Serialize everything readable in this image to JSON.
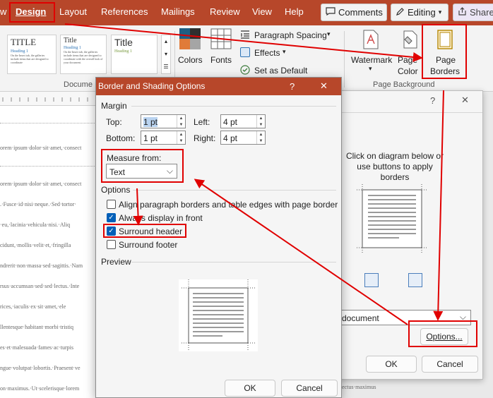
{
  "ribbon": {
    "tabs": [
      "w",
      "Design",
      "Layout",
      "References",
      "Mailings",
      "Review",
      "View",
      "Help"
    ],
    "comments_label": "Comments",
    "editing_label": "Editing",
    "share_label": "Share",
    "style_thumbs": [
      {
        "title": "TITLE",
        "heading": "Heading 1",
        "body": "On the Insert tab, the galleries include items that are designed to coordinate"
      },
      {
        "title": "Title",
        "heading": "Heading 1",
        "body": "On the Insert tab, the galleries include items that are designed to coordinate with the overall look of your document."
      },
      {
        "title": "Title",
        "heading": "Heading 1",
        "body": ""
      }
    ],
    "colors_label": "Colors",
    "fonts_label": "Fonts",
    "paragraph_spacing_label": "Paragraph Spacing",
    "effects_label": "Effects",
    "set_default_label": "Set as Default",
    "watermark_label": "Watermark",
    "page_color_label_1": "Page",
    "page_color_label_2": "Color",
    "page_borders_label_1": "Page",
    "page_borders_label_2": "Borders",
    "group_document_formatting": "Docume",
    "group_page_background": "Page Background"
  },
  "document": {
    "lines": [
      "orem·ipsum·dolor·sit·amet,·consect",
      "orem·ipsum·dolor·sit·amet,·consect",
      ".·Fusce·id·nisi·neque.·Sed·tortor·",
      "·eu,·lacinia·vehicula·nisi.·Aliq",
      "cidunt,·mollis·velit·et,·fringilla",
      "ndrerit·non·massa·sed·sagittis.·Nam",
      "rsus·accumsan·sed·sed·lectus.·Inte",
      "rices,·iaculis·ex·sit·amet,·ele",
      "llentesque·habitant·morbi·tristiq",
      "es·et·malesuada·fames·ac·turpis",
      "ngue·volutpat·lobortis.·Praesent·ve",
      "on·maximus.·Ut·scelerisque·lorem"
    ],
    "fragment_right": "ectus·maximus"
  },
  "bg_dialog": {
    "help_glyph": "?",
    "close_glyph": "✕",
    "instructions": "Click on diagram below or use buttons to apply borders",
    "apply_to_value": "document",
    "options_button": "Options...",
    "ok_button": "OK",
    "cancel_button": "Cancel"
  },
  "dialog": {
    "title": "Border and Shading Options",
    "help_glyph": "?",
    "close_glyph": "✕",
    "margin_section": "Margin",
    "top_label": "Top:",
    "top_value": "1 pt",
    "left_label": "Left:",
    "left_value": "4 pt",
    "bottom_label": "Bottom:",
    "bottom_value": "1 pt",
    "right_label": "Right:",
    "right_value": "4 pt",
    "measure_from_label": "Measure from:",
    "measure_from_value": "Text",
    "options_section": "Options",
    "options": [
      {
        "label": "Align paragraph borders and table edges with page border",
        "checked": false
      },
      {
        "label": "Always display in front",
        "checked": true
      },
      {
        "label": "Surround header",
        "checked": true
      },
      {
        "label": "Surround footer",
        "checked": false
      }
    ],
    "preview_section": "Preview",
    "ok_button": "OK",
    "cancel_button": "Cancel"
  },
  "colors": {
    "accent": "#b7472a",
    "annotation": "#e00000",
    "checkbox_on": "#005fb8"
  }
}
